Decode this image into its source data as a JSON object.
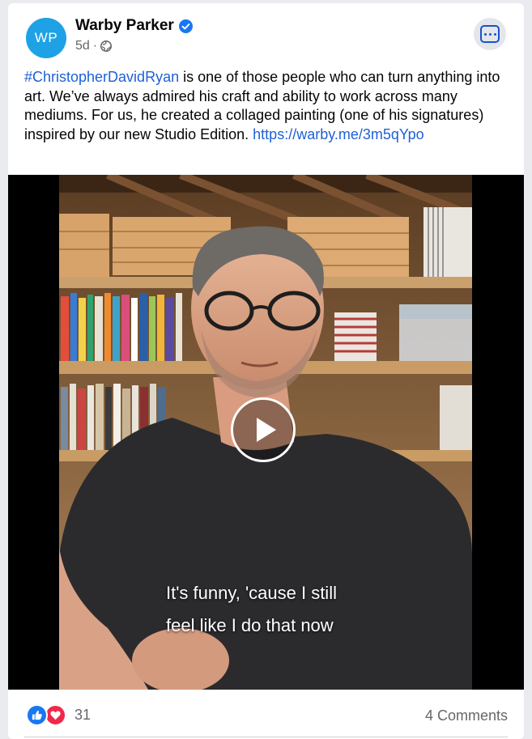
{
  "post": {
    "avatar_initials": "WP",
    "page_name": "Warby Parker",
    "timestamp": "5d",
    "separator": "·",
    "caption": {
      "hashtag": "#ChristopherDavidRyan",
      "text": " is one of those people who can turn anything into art. We’ve always admired his craft and ability to work across many mediums. For us, he created a collaged painting (one of his signatures) inspired by our new Studio Edition. ",
      "link": "https://warby.me/3m5qYpo"
    },
    "video": {
      "subtitle_line1": "It's funny, 'cause I still",
      "subtitle_line2": "feel like I do that now"
    },
    "footer": {
      "reaction_count": "31",
      "comments": "4 Comments"
    }
  },
  "colors": {
    "accent": "#1877f2",
    "avatar": "#1fa1e5",
    "link": "#1d61d6",
    "love": "#f0284a"
  },
  "icons": [
    "verified-badge-icon",
    "globe-icon",
    "more-options-icon",
    "play-icon",
    "like-reaction-icon",
    "love-reaction-icon"
  ]
}
